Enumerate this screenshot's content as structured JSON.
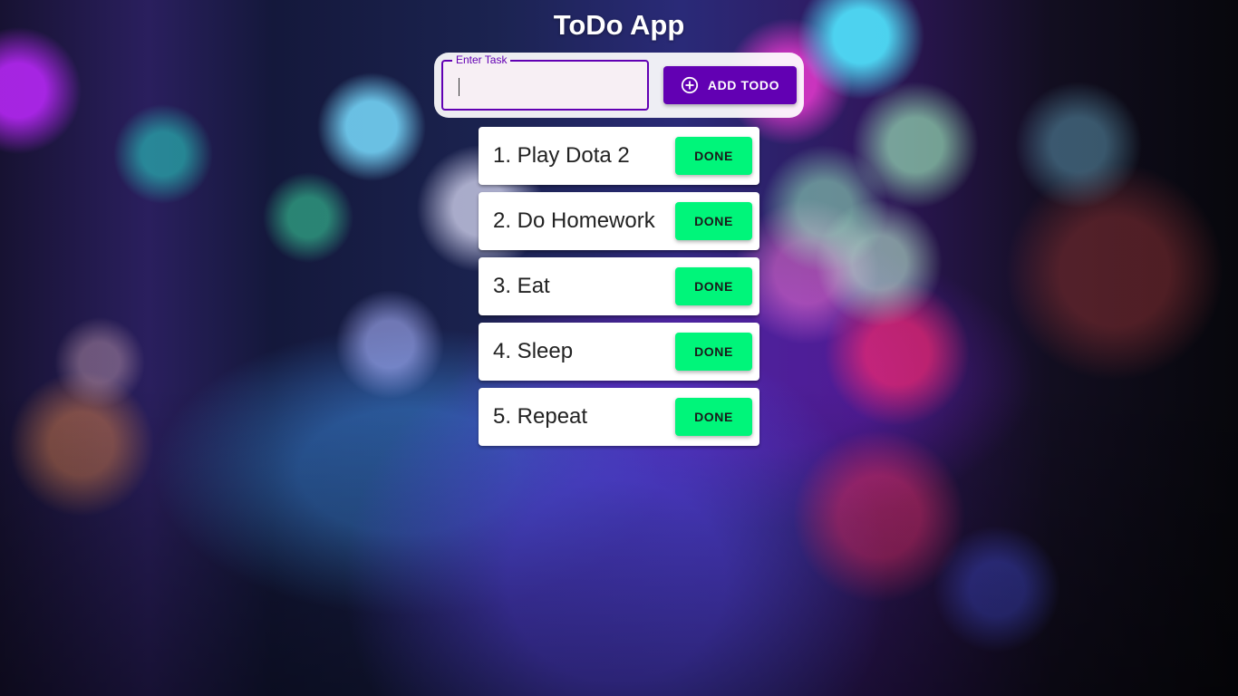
{
  "app": {
    "title": "ToDo App"
  },
  "form": {
    "input_label": "Enter Task",
    "input_value": "",
    "add_button_label": "ADD TODO",
    "add_button_icon": "add-circle-outline-icon"
  },
  "todos": [
    {
      "text": "1. Play Dota 2",
      "done_label": "DONE"
    },
    {
      "text": "2. Do Homework",
      "done_label": "DONE"
    },
    {
      "text": "3. Eat",
      "done_label": "DONE"
    },
    {
      "text": "4. Sleep",
      "done_label": "DONE"
    },
    {
      "text": "5. Repeat",
      "done_label": "DONE"
    }
  ],
  "colors": {
    "primary": "#6200b3",
    "done_button": "#00f57a",
    "title_text": "#ffffff"
  }
}
